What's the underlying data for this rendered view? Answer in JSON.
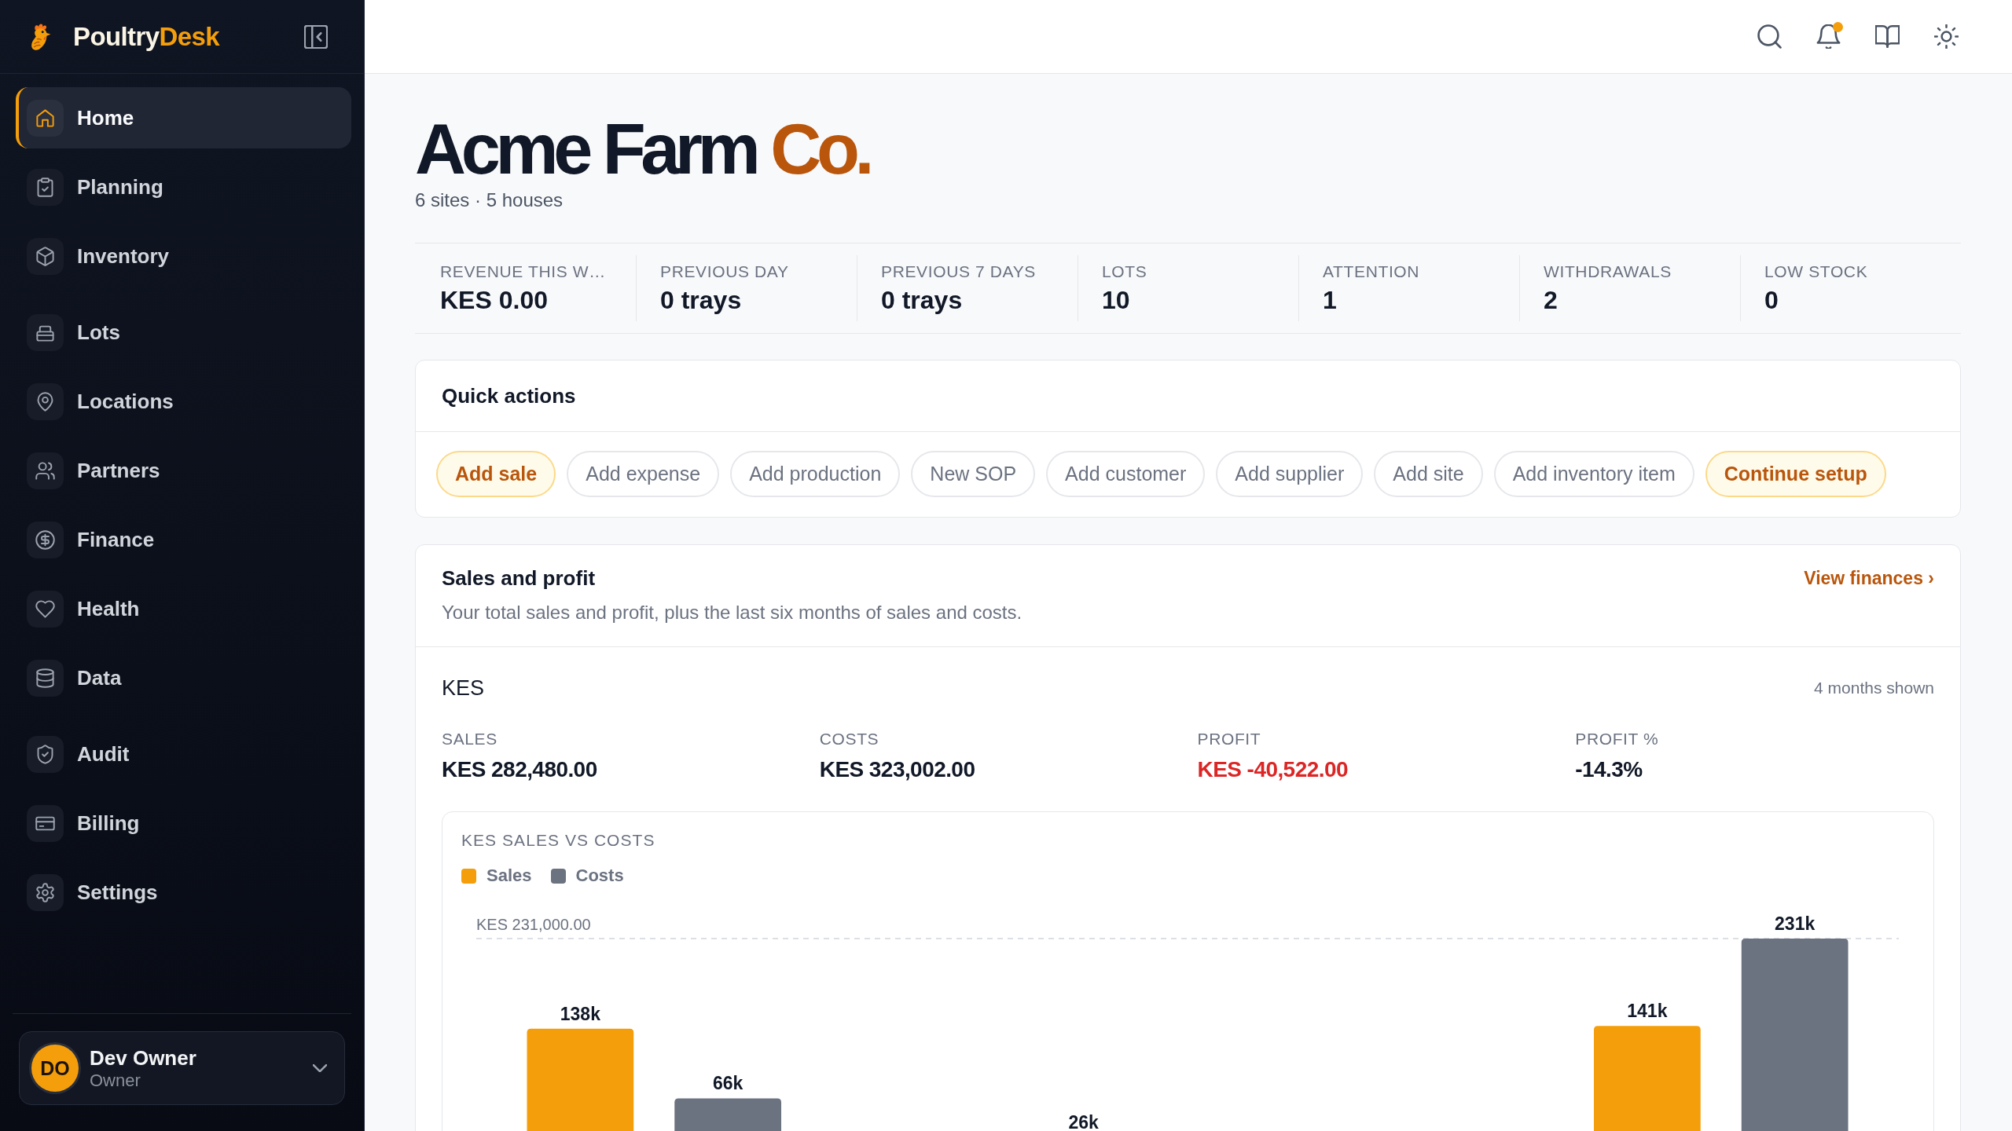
{
  "sidebar": {
    "brand": {
      "name": "Poultry",
      "accent": "Desk"
    },
    "nav_groups": [
      {
        "items": [
          {
            "label": "Home",
            "selected": true
          },
          {
            "label": "Planning",
            "selected": false
          },
          {
            "label": "Inventory",
            "selected": false
          }
        ]
      },
      {
        "items": [
          {
            "label": "Lots",
            "selected": false
          },
          {
            "label": "Locations",
            "selected": false
          },
          {
            "label": "Partners",
            "selected": false
          },
          {
            "label": "Finance",
            "selected": false
          },
          {
            "label": "Health",
            "selected": false
          },
          {
            "label": "Data",
            "selected": false
          }
        ]
      },
      {
        "items": [
          {
            "label": "Audit",
            "selected": false
          },
          {
            "label": "Billing",
            "selected": false
          },
          {
            "label": "Settings",
            "selected": false
          }
        ]
      }
    ],
    "user": {
      "initials": "DO",
      "name": "Dev Owner",
      "role": "Owner"
    }
  },
  "header": {
    "bell_unread": true
  },
  "page": {
    "title": {
      "main": "Acme Farm",
      "accent": "Co."
    },
    "subtitle": "6 sites · 5 houses"
  },
  "stats": [
    {
      "label": "REVENUE THIS W…",
      "value": "KES 0.00"
    },
    {
      "label": "PREVIOUS DAY",
      "value": "0 trays"
    },
    {
      "label": "PREVIOUS 7 DAYS",
      "value": "0 trays"
    },
    {
      "label": "LOTS",
      "value": "10"
    },
    {
      "label": "ATTENTION",
      "value": "1"
    },
    {
      "label": "WITHDRAWALS",
      "value": "2"
    },
    {
      "label": "LOW STOCK",
      "value": "0"
    }
  ],
  "quick_actions": {
    "title": "Quick actions",
    "actions": [
      {
        "label": "Add sale",
        "highlighted": true
      },
      {
        "label": "Add expense",
        "highlighted": false
      },
      {
        "label": "Add production",
        "highlighted": false
      },
      {
        "label": "New SOP",
        "highlighted": false
      },
      {
        "label": "Add customer",
        "highlighted": false
      },
      {
        "label": "Add supplier",
        "highlighted": false
      },
      {
        "label": "Add site",
        "highlighted": false
      },
      {
        "label": "Add inventory item",
        "highlighted": false
      },
      {
        "label": "Continue setup",
        "highlighted": true
      }
    ]
  },
  "sales_profit": {
    "title": "Sales and profit",
    "description": "Your total sales and profit, plus the last six months of sales and costs.",
    "link": "View finances ›",
    "currency": "KES",
    "months_note": "4 months shown",
    "metrics": [
      {
        "label": "SALES",
        "value": "KES 282,480.00",
        "warning": false
      },
      {
        "label": "COSTS",
        "value": "KES 323,002.00",
        "warning": false
      },
      {
        "label": "PROFIT",
        "value": "KES -40,522.00",
        "warning": true
      },
      {
        "label": "PROFIT %",
        "value": "-14.3%",
        "warning": false
      }
    ],
    "chart": {
      "title": "KES SALES VS COSTS",
      "legend": [
        {
          "name": "Sales",
          "color": "#f59e0b"
        },
        {
          "name": "Costs",
          "color": "#6b7280"
        }
      ],
      "reference_label": "KES 231,000.00",
      "bar_labels": [
        "138k",
        "66k",
        "26k",
        "141k",
        "231k"
      ]
    }
  }
}
